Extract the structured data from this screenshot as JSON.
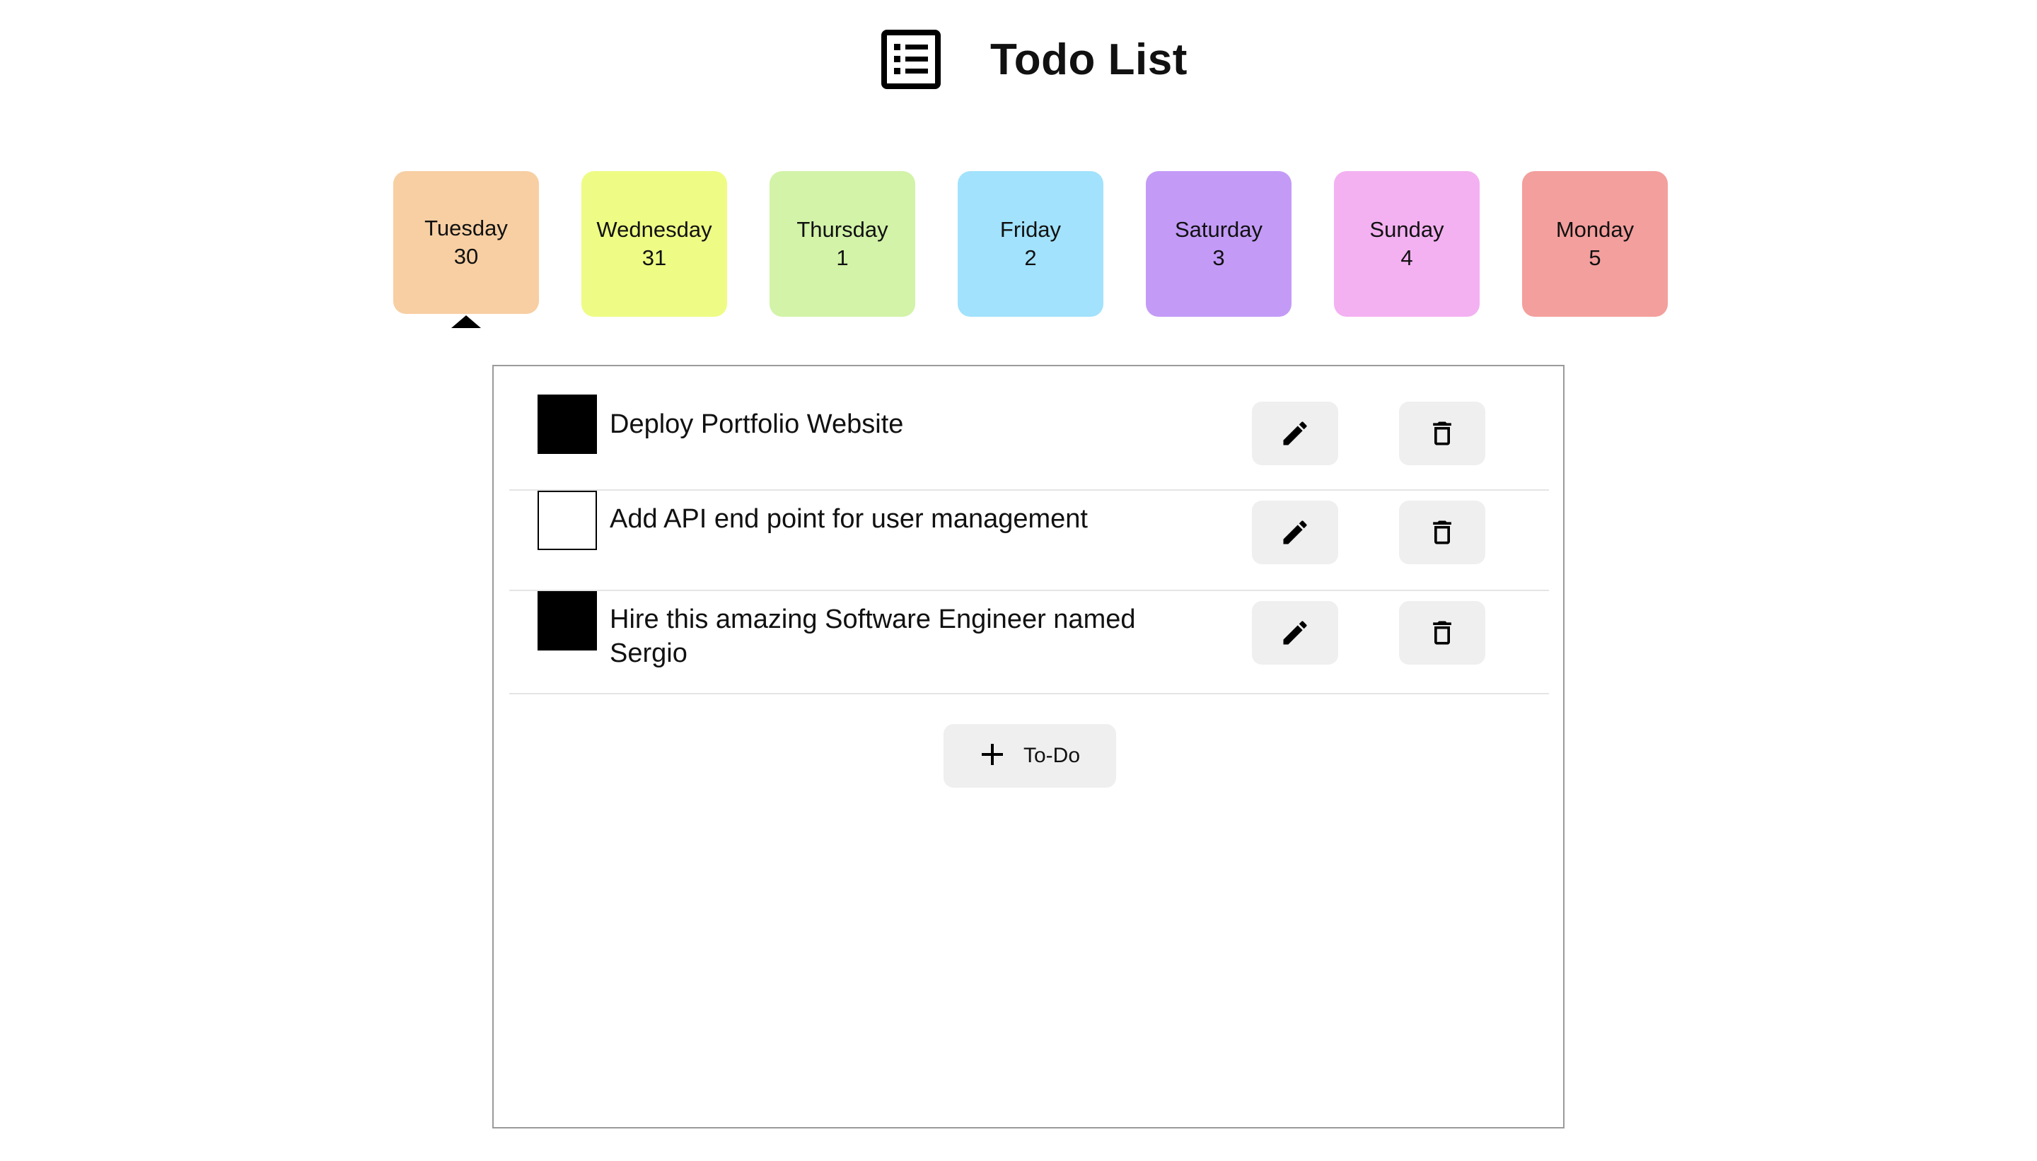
{
  "header": {
    "title": "Todo List",
    "icon": "list-icon"
  },
  "days": [
    {
      "name": "Tuesday",
      "date": "30",
      "color": "#f7cfa3",
      "selected": true
    },
    {
      "name": "Wednesday",
      "date": "31",
      "color": "#eefc85",
      "selected": false
    },
    {
      "name": "Thursday",
      "date": "1",
      "color": "#d2f3a8",
      "selected": false
    },
    {
      "name": "Friday",
      "date": "2",
      "color": "#a2e2fc",
      "selected": false
    },
    {
      "name": "Saturday",
      "date": "3",
      "color": "#c39bf7",
      "selected": false
    },
    {
      "name": "Sunday",
      "date": "4",
      "color": "#f3b1f1",
      "selected": false
    },
    {
      "name": "Monday",
      "date": "5",
      "color": "#f39f9d",
      "selected": false
    }
  ],
  "todos": [
    {
      "text": "Deploy Portfolio Website",
      "completed": true
    },
    {
      "text": "Add API end point for user management",
      "completed": false
    },
    {
      "text": "Hire this amazing Software Engineer named Sergio",
      "completed": true
    }
  ],
  "add_button": {
    "label": "To-Do",
    "icon": "plus-icon"
  },
  "icons": {
    "edit": "pencil-icon",
    "delete": "trash-icon"
  }
}
